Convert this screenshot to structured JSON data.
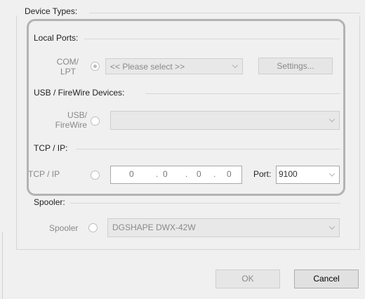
{
  "dialog": {
    "device_types_label": "Device Types:",
    "local_ports": {
      "heading": "Local Ports:",
      "label": "COM/\nLPT",
      "label_line1": "COM/",
      "label_line2": "LPT",
      "combo_value": "<< Please select >>",
      "settings_button": "Settings..."
    },
    "usb": {
      "heading": "USB / FireWire Devices:",
      "label_line1": "USB/",
      "label_line2": "FireWire",
      "combo_value": ""
    },
    "tcp": {
      "heading": "TCP / IP:",
      "label": "TCP / IP",
      "ip": [
        "0",
        "0",
        "0",
        "0"
      ],
      "port_label": "Port:",
      "port_value": "9100"
    },
    "spooler": {
      "heading": "Spooler:",
      "label": "Spooler",
      "combo_value": "DGSHAPE DWX-42W"
    },
    "buttons": {
      "ok": "OK",
      "cancel": "Cancel"
    }
  }
}
